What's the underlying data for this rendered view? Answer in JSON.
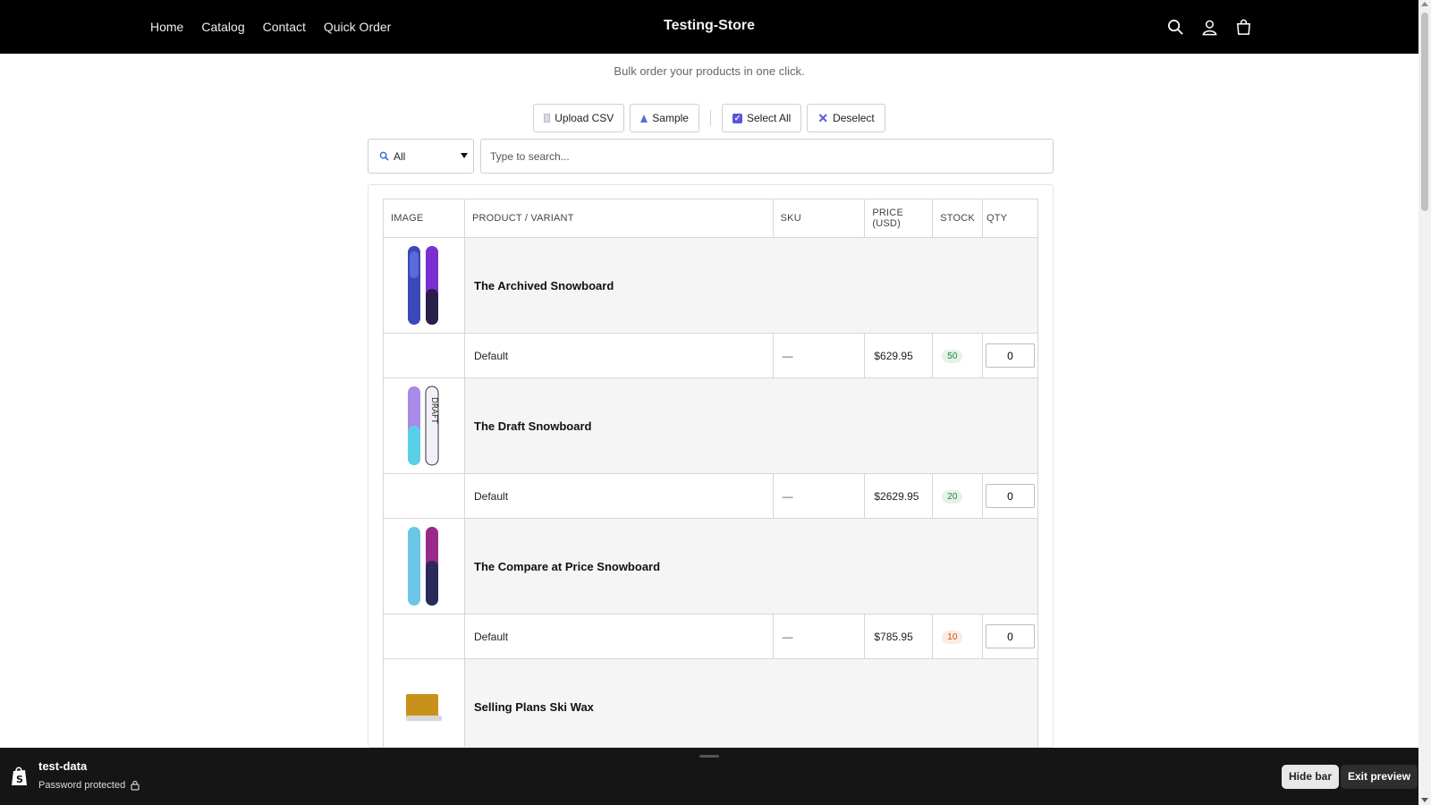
{
  "header": {
    "nav": [
      "Home",
      "Catalog",
      "Contact",
      "Quick Order"
    ],
    "store_title": "Testing-Store",
    "icons": [
      "search-icon",
      "account-icon",
      "cart-icon"
    ]
  },
  "page": {
    "subtitle": "Bulk order your products in one click."
  },
  "toolbar": {
    "upload_csv": "Upload CSV",
    "sample": "Sample",
    "select_all": "Select All",
    "deselect": "Deselect"
  },
  "filter": {
    "selected": "All",
    "search_placeholder": "Type to search..."
  },
  "table": {
    "columns": [
      "IMAGE",
      "PRODUCT / VARIANT",
      "SKU",
      "PRICE (USD)",
      "STOCK",
      "QTY"
    ],
    "products": [
      {
        "name": "The Archived Snowboard",
        "variant": "Default",
        "sku": "—",
        "price": "$629.95",
        "stock": "50",
        "qty": "0"
      },
      {
        "name": "The Draft Snowboard",
        "variant": "Default",
        "sku": "—",
        "price": "$2629.95",
        "stock": "20",
        "qty": "0"
      },
      {
        "name": "The Compare at Price Snowboard",
        "variant": "Default",
        "sku": "—",
        "price": "$785.95",
        "stock": "10",
        "qty": "0"
      },
      {
        "name": "Selling Plans Ski Wax"
      }
    ]
  },
  "preview_bar": {
    "store_name": "test-data",
    "status": "Password protected",
    "hide_bar": "Hide bar",
    "exit_preview": "Exit preview"
  },
  "colors": {
    "header_bg": "#000000",
    "accent": "#5a55d8",
    "stock_ok": "#2e7d3b",
    "stock_low": "#c2571a",
    "preview_bar_bg": "#151515"
  }
}
